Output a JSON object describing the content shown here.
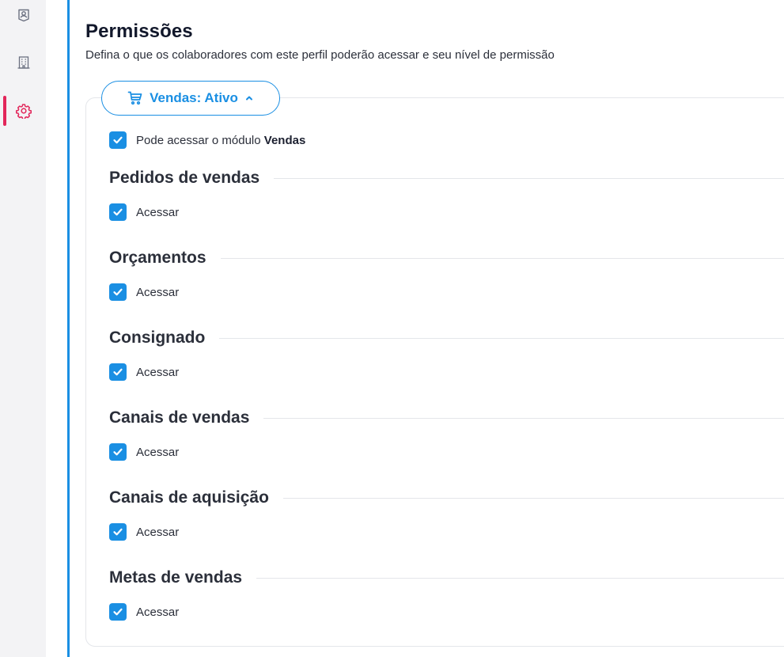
{
  "header": {
    "title": "Permissões",
    "subtitle": "Defina o que os colaboradores com este perfil poderão acessar e seu nível de permissão"
  },
  "sidebar": {
    "icons": [
      "user-badge-icon",
      "building-icon",
      "gear-icon"
    ],
    "active": "gear-icon"
  },
  "module": {
    "label": "Vendas: Ativo",
    "icon": "shopping-cart-icon",
    "access_prefix": "Pode acessar o módulo ",
    "access_module": "Vendas",
    "access_checked": true
  },
  "sections": [
    {
      "title": "Pedidos de vendas",
      "checkbox_label": "Acessar",
      "checked": true
    },
    {
      "title": "Orçamentos",
      "checkbox_label": "Acessar",
      "checked": true
    },
    {
      "title": "Consignado",
      "checkbox_label": "Acessar",
      "checked": true
    },
    {
      "title": "Canais de vendas",
      "checkbox_label": "Acessar",
      "checked": true
    },
    {
      "title": "Canais de aquisição",
      "checkbox_label": "Acessar",
      "checked": true
    },
    {
      "title": "Metas de vendas",
      "checkbox_label": "Acessar",
      "checked": true
    }
  ],
  "colors": {
    "accent": "#1a8fe3",
    "active_nav": "#e2265a",
    "sidebar_bg": "#f3f3f5"
  }
}
